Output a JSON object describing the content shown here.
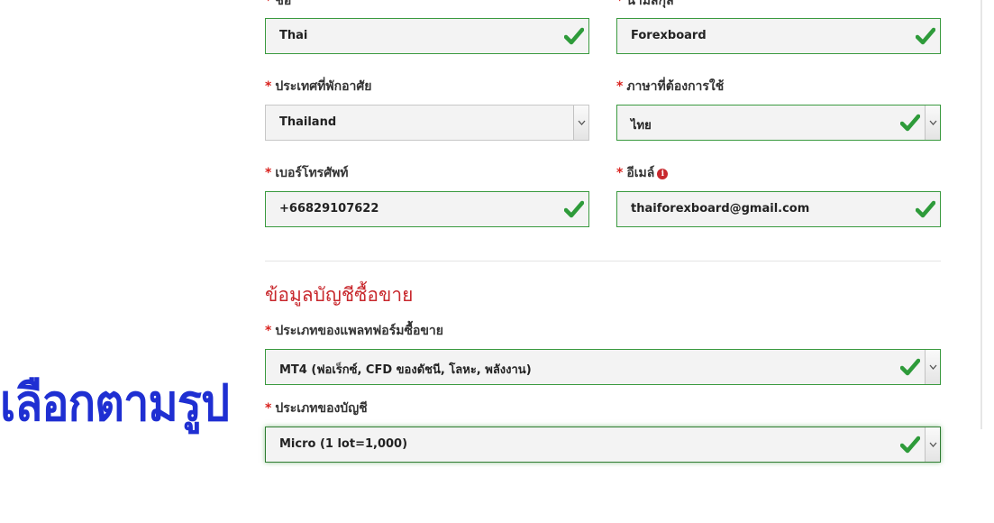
{
  "form": {
    "first_name": {
      "label": "ชื่อ",
      "value": "Thai"
    },
    "last_name": {
      "label": "นามสกุล",
      "value": "Forexboard"
    },
    "country": {
      "label": "ประเทศที่พักอาศัย",
      "value": "Thailand"
    },
    "language": {
      "label": "ภาษาที่ต้องการใช้",
      "value": "ไทย"
    },
    "phone": {
      "label": "เบอร์โทรศัพท์",
      "value": "+66829107622"
    },
    "email": {
      "label": "อีเมล์",
      "value": "thaiforexboard@gmail.com",
      "info_icon": "i"
    },
    "required_marker": "*"
  },
  "trading_account": {
    "section_title": "ข้อมูลบัญชีซื้อขาย",
    "platform": {
      "label": "ประเภทของแพลทฟอร์มซื้อขาย",
      "value": "MT4 (ฟอเร็กซ์, CFD ของดัชนี, โลหะ, พลังงาน)"
    },
    "account_type": {
      "label": "ประเภทของบัญชี",
      "value": "Micro (1 lot=1,000)"
    }
  },
  "annotation": {
    "text": "เลือกตามรูป"
  },
  "colors": {
    "valid_border": "#3a9a3f",
    "checkmark": "#2e9b3a",
    "required": "#d9231f",
    "section_title": "#c8282d",
    "annotation": "#1f2fd2"
  },
  "icons": {
    "valid": "checkmark-icon",
    "dropdown": "chevron-down-icon",
    "info": "info-icon"
  }
}
